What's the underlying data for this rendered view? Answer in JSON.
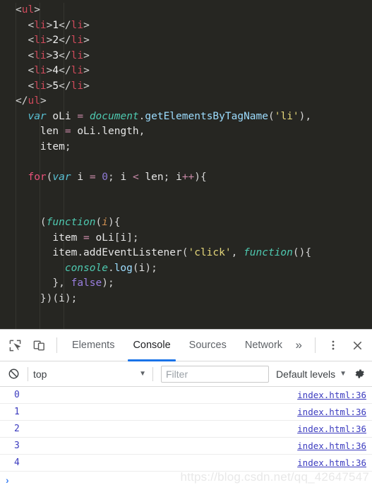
{
  "editor": {
    "theme": "dark",
    "background": "#262622",
    "lines": [
      {
        "id": "l1",
        "indent": 0,
        "tokens": [
          {
            "t": "<",
            "c": "punc"
          },
          {
            "t": "ul",
            "c": "tag"
          },
          {
            "t": ">",
            "c": "punc"
          }
        ]
      },
      {
        "id": "l2",
        "indent": 1,
        "tokens": [
          {
            "t": "<",
            "c": "punc"
          },
          {
            "t": "li",
            "c": "tag"
          },
          {
            "t": ">",
            "c": "punc"
          },
          {
            "t": "1",
            "c": "txt"
          },
          {
            "t": "</",
            "c": "punc"
          },
          {
            "t": "li",
            "c": "tag"
          },
          {
            "t": ">",
            "c": "punc"
          }
        ]
      },
      {
        "id": "l3",
        "indent": 1,
        "tokens": [
          {
            "t": "<",
            "c": "punc"
          },
          {
            "t": "li",
            "c": "tag"
          },
          {
            "t": ">",
            "c": "punc"
          },
          {
            "t": "2",
            "c": "txt"
          },
          {
            "t": "</",
            "c": "punc"
          },
          {
            "t": "li",
            "c": "tag"
          },
          {
            "t": ">",
            "c": "punc"
          }
        ]
      },
      {
        "id": "l4",
        "indent": 1,
        "tokens": [
          {
            "t": "<",
            "c": "punc"
          },
          {
            "t": "li",
            "c": "tag"
          },
          {
            "t": ">",
            "c": "punc"
          },
          {
            "t": "3",
            "c": "txt"
          },
          {
            "t": "</",
            "c": "punc"
          },
          {
            "t": "li",
            "c": "tag"
          },
          {
            "t": ">",
            "c": "punc"
          }
        ]
      },
      {
        "id": "l5",
        "indent": 1,
        "tokens": [
          {
            "t": "<",
            "c": "punc"
          },
          {
            "t": "li",
            "c": "tag"
          },
          {
            "t": ">",
            "c": "punc"
          },
          {
            "t": "4",
            "c": "txt"
          },
          {
            "t": "</",
            "c": "punc"
          },
          {
            "t": "li",
            "c": "tag"
          },
          {
            "t": ">",
            "c": "punc"
          }
        ]
      },
      {
        "id": "l6",
        "indent": 1,
        "tokens": [
          {
            "t": "<",
            "c": "punc"
          },
          {
            "t": "li",
            "c": "tag"
          },
          {
            "t": ">",
            "c": "punc"
          },
          {
            "t": "5",
            "c": "txt"
          },
          {
            "t": "</",
            "c": "punc"
          },
          {
            "t": "li",
            "c": "tag"
          },
          {
            "t": ">",
            "c": "punc"
          }
        ]
      },
      {
        "id": "l7",
        "indent": 0,
        "tokens": [
          {
            "t": "</",
            "c": "punc"
          },
          {
            "t": "ul",
            "c": "tag"
          },
          {
            "t": ">",
            "c": "punc"
          }
        ]
      },
      {
        "id": "l8",
        "indent": 1,
        "tokens": [
          {
            "t": "var",
            "c": "var"
          },
          {
            "t": " ",
            "c": "txt"
          },
          {
            "t": "oLi",
            "c": "ident"
          },
          {
            "t": " ",
            "c": "txt"
          },
          {
            "t": "=",
            "c": "oper"
          },
          {
            "t": " ",
            "c": "txt"
          },
          {
            "t": "document",
            "c": "kw2"
          },
          {
            "t": ".",
            "c": "punc"
          },
          {
            "t": "getElementsByTagName",
            "c": "prop"
          },
          {
            "t": "(",
            "c": "punc"
          },
          {
            "t": "'li'",
            "c": "str"
          },
          {
            "t": "),",
            "c": "punc"
          }
        ]
      },
      {
        "id": "l9",
        "indent": 2,
        "tokens": [
          {
            "t": "len",
            "c": "ident"
          },
          {
            "t": " ",
            "c": "txt"
          },
          {
            "t": "=",
            "c": "oper"
          },
          {
            "t": " ",
            "c": "txt"
          },
          {
            "t": "oLi",
            "c": "ident"
          },
          {
            "t": ".",
            "c": "punc"
          },
          {
            "t": "length",
            "c": "ident"
          },
          {
            "t": ",",
            "c": "punc"
          }
        ]
      },
      {
        "id": "l10",
        "indent": 2,
        "tokens": [
          {
            "t": "item",
            "c": "ident"
          },
          {
            "t": ";",
            "c": "punc"
          }
        ]
      },
      {
        "id": "l11",
        "indent": 0,
        "tokens": []
      },
      {
        "id": "l12",
        "indent": 1,
        "tokens": [
          {
            "t": "for",
            "c": "kw"
          },
          {
            "t": "(",
            "c": "punc"
          },
          {
            "t": "var",
            "c": "var"
          },
          {
            "t": " ",
            "c": "txt"
          },
          {
            "t": "i",
            "c": "ident"
          },
          {
            "t": " ",
            "c": "txt"
          },
          {
            "t": "=",
            "c": "oper"
          },
          {
            "t": " ",
            "c": "txt"
          },
          {
            "t": "0",
            "c": "num"
          },
          {
            "t": "; ",
            "c": "punc"
          },
          {
            "t": "i",
            "c": "ident"
          },
          {
            "t": " ",
            "c": "txt"
          },
          {
            "t": "<",
            "c": "oper"
          },
          {
            "t": " ",
            "c": "txt"
          },
          {
            "t": "len",
            "c": "ident"
          },
          {
            "t": "; ",
            "c": "punc"
          },
          {
            "t": "i",
            "c": "ident"
          },
          {
            "t": "++",
            "c": "oper"
          },
          {
            "t": "){",
            "c": "punc"
          }
        ]
      },
      {
        "id": "l13",
        "indent": 0,
        "tokens": []
      },
      {
        "id": "l14",
        "indent": 0,
        "tokens": []
      },
      {
        "id": "l15",
        "indent": 2,
        "tokens": [
          {
            "t": "(",
            "c": "punc"
          },
          {
            "t": "function",
            "c": "kw2"
          },
          {
            "t": "(",
            "c": "punc"
          },
          {
            "t": "i",
            "c": "param"
          },
          {
            "t": "){",
            "c": "punc"
          }
        ]
      },
      {
        "id": "l16",
        "indent": 3,
        "tokens": [
          {
            "t": "item",
            "c": "ident"
          },
          {
            "t": " ",
            "c": "txt"
          },
          {
            "t": "=",
            "c": "oper"
          },
          {
            "t": " ",
            "c": "txt"
          },
          {
            "t": "oLi",
            "c": "ident"
          },
          {
            "t": "[",
            "c": "punc"
          },
          {
            "t": "i",
            "c": "ident"
          },
          {
            "t": "];",
            "c": "punc"
          }
        ]
      },
      {
        "id": "l17",
        "indent": 3,
        "tokens": [
          {
            "t": "item",
            "c": "ident"
          },
          {
            "t": ".",
            "c": "punc"
          },
          {
            "t": "addEventListener",
            "c": "ident"
          },
          {
            "t": "(",
            "c": "punc"
          },
          {
            "t": "'click'",
            "c": "str"
          },
          {
            "t": ", ",
            "c": "punc"
          },
          {
            "t": "function",
            "c": "kw2"
          },
          {
            "t": "(){",
            "c": "punc"
          }
        ]
      },
      {
        "id": "l18",
        "indent": 4,
        "tokens": [
          {
            "t": "console",
            "c": "kw2"
          },
          {
            "t": ".",
            "c": "punc"
          },
          {
            "t": "log",
            "c": "prop"
          },
          {
            "t": "(",
            "c": "punc"
          },
          {
            "t": "i",
            "c": "ident"
          },
          {
            "t": ");",
            "c": "punc"
          }
        ]
      },
      {
        "id": "l19",
        "indent": 3,
        "tokens": [
          {
            "t": "}, ",
            "c": "punc"
          },
          {
            "t": "false",
            "c": "bool"
          },
          {
            "t": ");",
            "c": "punc"
          }
        ]
      },
      {
        "id": "l20",
        "indent": 2,
        "tokens": [
          {
            "t": "})(",
            "c": "punc"
          },
          {
            "t": "i",
            "c": "ident"
          },
          {
            "t": ");",
            "c": "punc"
          }
        ]
      },
      {
        "id": "l21",
        "indent": 0,
        "tokens": []
      },
      {
        "id": "l22",
        "indent": 0,
        "tokens": []
      },
      {
        "id": "l23",
        "indent": 1,
        "tokens": [
          {
            "t": "}",
            "c": "punc"
          }
        ]
      }
    ]
  },
  "devtools": {
    "toolbar": {
      "inspect_icon": "inspect-element-icon",
      "device_icon": "device-toolbar-icon",
      "more_tabs_label": "»",
      "menu_icon": "kebab-menu-icon",
      "close_icon": "close-icon",
      "accent_color": "#1a73e8"
    },
    "tabs": [
      {
        "label": "Elements",
        "active": false
      },
      {
        "label": "Console",
        "active": true
      },
      {
        "label": "Sources",
        "active": false
      },
      {
        "label": "Network",
        "active": false
      }
    ],
    "filterbar": {
      "clear_icon": "clear-console-icon",
      "context_value": "top",
      "context_caret": "▼",
      "filter_placeholder": "Filter",
      "filter_value": "",
      "levels_label": "Default levels",
      "levels_caret": "▼",
      "settings_icon": "gear-icon"
    },
    "console": {
      "rows": [
        {
          "message": "0",
          "source": "index.html:36"
        },
        {
          "message": "1",
          "source": "index.html:36"
        },
        {
          "message": "2",
          "source": "index.html:36"
        },
        {
          "message": "3",
          "source": "index.html:36"
        },
        {
          "message": "4",
          "source": "index.html:36"
        }
      ],
      "prompt": "›"
    }
  },
  "watermark": {
    "text": "https://blog.csdn.net/qq_42647547"
  }
}
